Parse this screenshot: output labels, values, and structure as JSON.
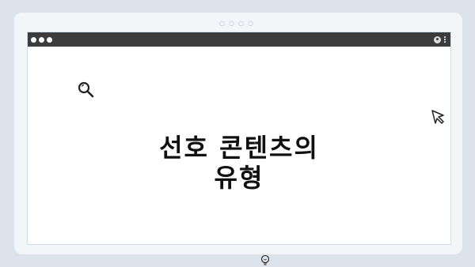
{
  "page": {
    "heading_line1": "선호 콘텐츠의",
    "heading_line2": "유형"
  },
  "icons": {
    "top": "pager-dots-icon",
    "search": "search-icon",
    "cursor": "cursor-icon",
    "bulb": "lightbulb-icon",
    "avatar": "avatar-icon",
    "menu": "more-vertical-icon"
  },
  "colors": {
    "background": "#dde3ea",
    "frame": "#f3f6f9",
    "titlebar": "#3c3c3c",
    "heading": "#111111"
  }
}
